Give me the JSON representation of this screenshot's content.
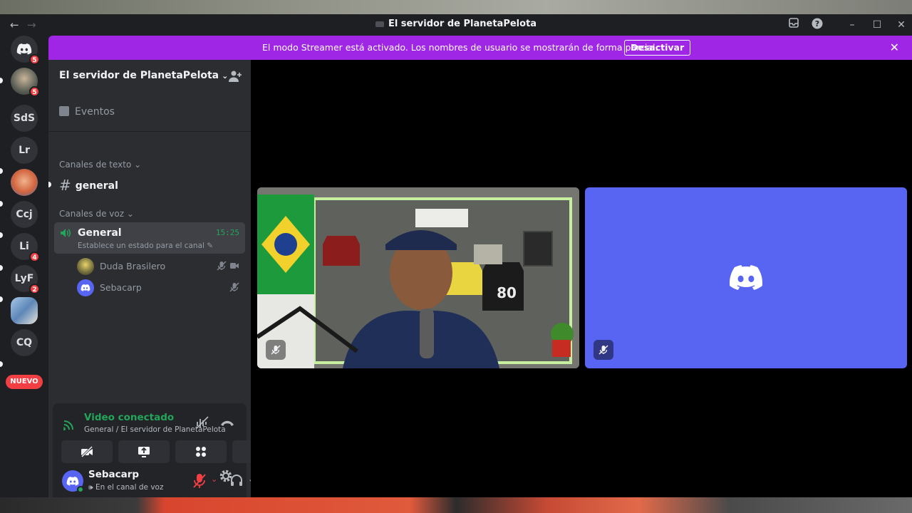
{
  "window": {
    "title": "El servidor de PlanetaPelota",
    "back": "←",
    "forward": "→"
  },
  "servers": [
    {
      "label": "",
      "badge": "5",
      "kind": "dm"
    },
    {
      "label": "",
      "badge": "5",
      "kind": "avatar"
    },
    {
      "label": "SdS",
      "badge": ""
    },
    {
      "label": "Lr",
      "badge": ""
    },
    {
      "label": "",
      "badge": "",
      "kind": "avatar"
    },
    {
      "label": "Ccj",
      "badge": ""
    },
    {
      "label": "Li",
      "badge": "4"
    },
    {
      "label": "LyF",
      "badge": "2"
    },
    {
      "label": "",
      "badge": "",
      "kind": "avatar"
    },
    {
      "label": "CQ",
      "badge": ""
    }
  ],
  "new_badge": "NUEVO",
  "banner": {
    "message": "El modo Streamer está activado. Los nombres de usuario se mostrarán de forma parcial.",
    "button": "Desactivar"
  },
  "sidebar": {
    "server_name": "El servidor de PlanetaPelota",
    "events_label": "Eventos",
    "text_category": "Canales de texto",
    "text_channel": "general",
    "voice_category": "Canales de voz",
    "voice_channel": {
      "name": "General",
      "timer": "15:25",
      "status_placeholder": "Establece un estado para el canal"
    },
    "voice_users": [
      {
        "name": "Duda Brasilero"
      },
      {
        "name": "Sebacarp"
      }
    ]
  },
  "connection": {
    "state": "Video conectado",
    "location": "General / El servidor de PlanetaPelota"
  },
  "user": {
    "name": "Sebacarp",
    "status": "En el canal de voz"
  },
  "colors": {
    "banner": "#a026e6",
    "blurple": "#5865f2",
    "online": "#23a55a",
    "danger": "#f23f43"
  }
}
